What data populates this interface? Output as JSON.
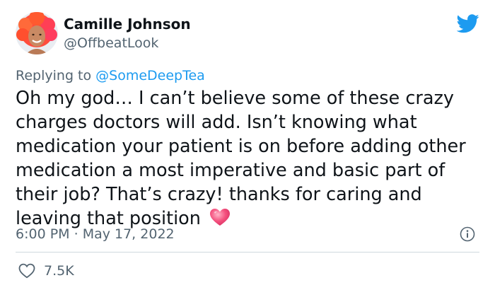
{
  "author": {
    "name": "Camille Johnson",
    "handle": "@OffbeatLook"
  },
  "reply": {
    "prefix": "Replying to ",
    "mention": "@SomeDeepTea"
  },
  "tweet": {
    "text": "Oh my god… I can’t believe some of these crazy charges doctors will add. Isn’t knowing what medication your patient is on before adding other medication a most imperative and basic part of their job? That’s crazy! thanks for caring and leaving that position",
    "emoji": "pink-heart-icon"
  },
  "meta": {
    "time": "6:00 PM",
    "separator": " · ",
    "date": "May 17, 2022"
  },
  "stats": {
    "likes": "7.5K"
  },
  "colors": {
    "brand_blue": "#1d9bf0",
    "text_primary": "#0f1419",
    "text_secondary": "#536471",
    "divider": "#cfd9de",
    "heart_pink": "#f4517e"
  }
}
